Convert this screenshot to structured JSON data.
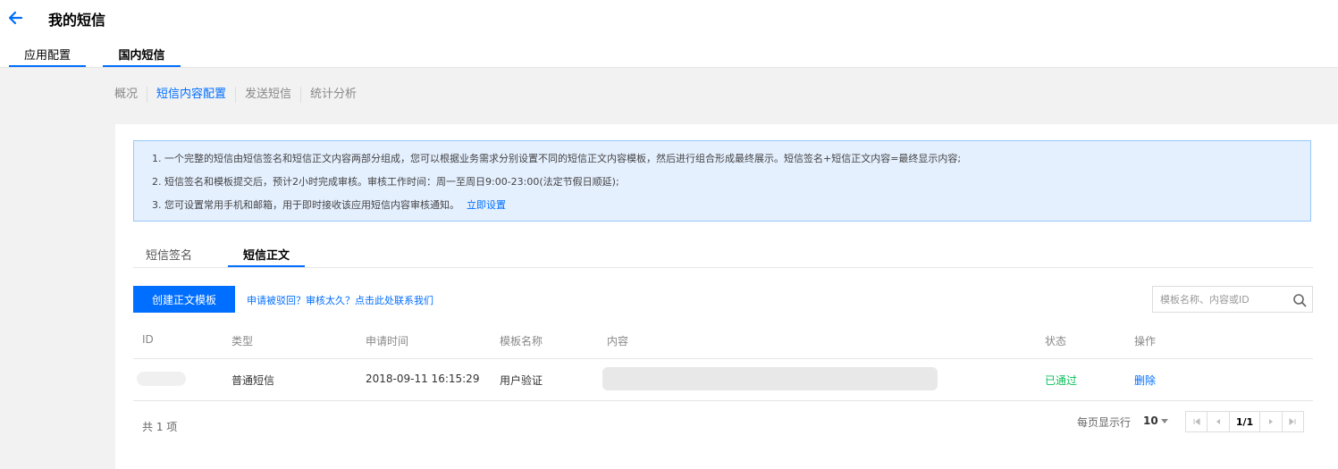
{
  "header": {
    "title": "我的短信",
    "back_icon": "arrow-left-icon"
  },
  "main_tabs": [
    {
      "label": "应用配置"
    },
    {
      "label": "国内短信"
    }
  ],
  "subnav": [
    {
      "label": "概况"
    },
    {
      "label": "短信内容配置"
    },
    {
      "label": "发送短信"
    },
    {
      "label": "统计分析"
    }
  ],
  "notice": {
    "line1": "1. 一个完整的短信由短信签名和短信正文内容两部分组成，您可以根据业务需求分别设置不同的短信正文内容模板，然后进行组合形成最终展示。短信签名+短信正文内容=最终显示内容;",
    "line2": "2. 短信签名和模板提交后，预计2小时完成审核。审核工作时间：周一至周日9:00-23:00(法定节假日顺延);",
    "line3": "3. 您可设置常用手机和邮箱，用于即时接收该应用短信内容审核通知。",
    "link": "立即设置"
  },
  "content_tabs": [
    {
      "label": "短信签名"
    },
    {
      "label": "短信正文"
    }
  ],
  "toolbar": {
    "create_label": "创建正文模板",
    "contact_link": "申请被驳回？审核太久？点击此处联系我们",
    "search_placeholder": "模板名称、内容或ID"
  },
  "table": {
    "headers": {
      "id": "ID",
      "type": "类型",
      "time": "申请时间",
      "name": "模板名称",
      "content": "内容",
      "status": "状态",
      "op": "操作"
    },
    "rows": [
      {
        "type": "普通短信",
        "time": "2018-09-11 16:15:29",
        "name": "用户验证",
        "status": "已通过",
        "op": "删除"
      }
    ]
  },
  "footer": {
    "total": "共 1 项",
    "per_page_label": "每页显示行",
    "page_size": "10",
    "page_indicator": "1/1"
  },
  "colors": {
    "accent": "#006eff",
    "success": "#0abf5b",
    "notice_bg": "#e5f0ff",
    "notice_border": "#97c7f6"
  }
}
